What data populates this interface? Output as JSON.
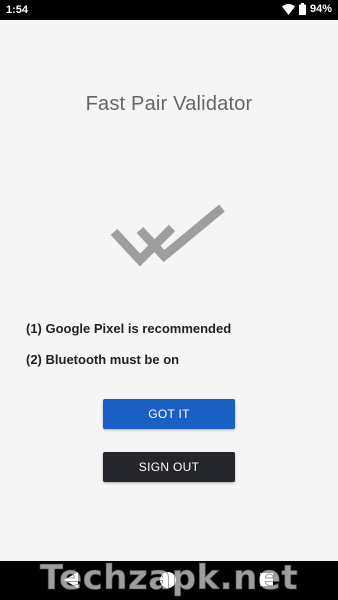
{
  "status_bar": {
    "time": "1:54",
    "battery_percent": "94%",
    "icons": [
      "wifi-icon",
      "battery-icon"
    ]
  },
  "app": {
    "title": "Fast Pair Validator",
    "logo_icon": "double-check-icon"
  },
  "requirements": [
    "(1) Google Pixel is recommended",
    "(2) Bluetooth must be on"
  ],
  "buttons": {
    "got_it": "GOT IT",
    "sign_out": "SIGN OUT"
  },
  "nav_bar": {
    "icons": [
      "back-icon",
      "home-icon",
      "recents-icon"
    ]
  },
  "watermark": "Techzapk.net",
  "colors": {
    "primary_button": "#1a5fc4",
    "secondary_button": "#24262b",
    "background": "#f5f5f5",
    "logo_gray": "#9e9e9e"
  }
}
